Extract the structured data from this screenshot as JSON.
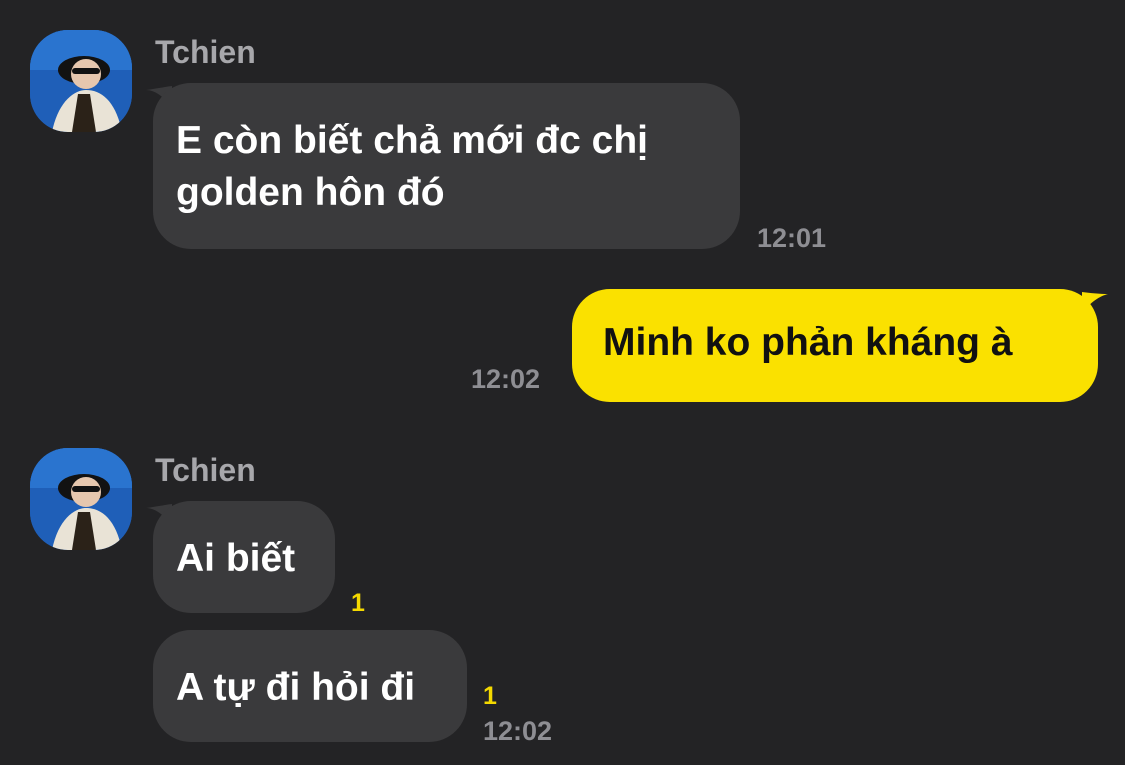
{
  "conversation": {
    "messages": [
      {
        "direction": "incoming",
        "sender": "Tchien",
        "lines": [
          "E còn biết chả mới đc chị",
          "golden hôn đó"
        ],
        "time": "12:01"
      },
      {
        "direction": "outgoing",
        "text": "Minh ko phản kháng à",
        "time": "12:02"
      },
      {
        "direction": "incoming",
        "sender": "Tchien",
        "text": "Ai biết",
        "unread": "1"
      },
      {
        "direction": "incoming",
        "text": "A tự đi hỏi đi",
        "unread": "1",
        "time": "12:02"
      }
    ]
  },
  "colors": {
    "background": "#232325",
    "incoming_bubble": "#3a3a3c",
    "outgoing_bubble": "#fae100",
    "unread_count": "#f4d900"
  },
  "icons": {
    "avatar": "profile-photo"
  }
}
